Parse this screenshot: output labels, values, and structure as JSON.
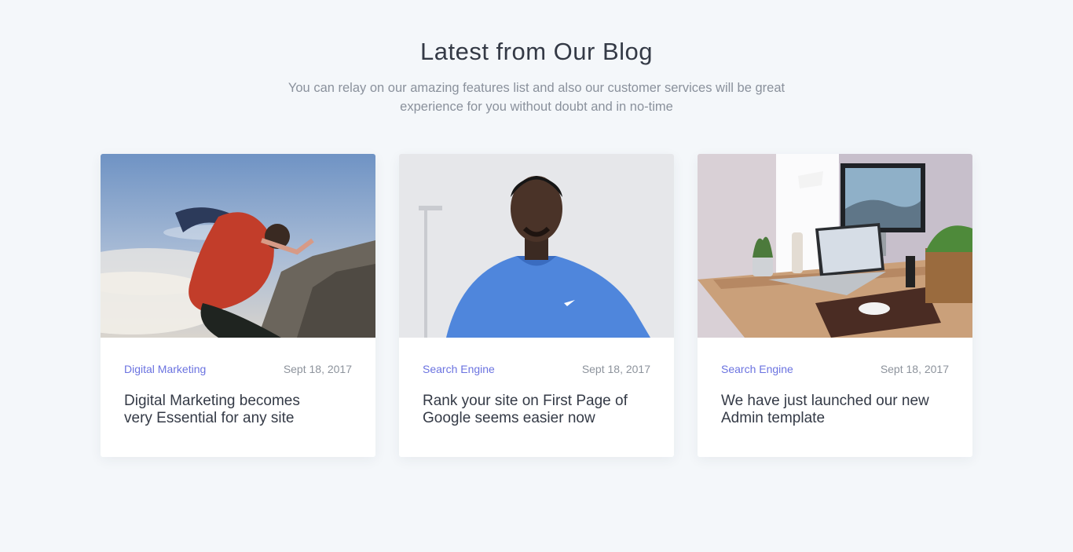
{
  "section": {
    "title": "Latest from Our Blog",
    "subtitle_line1": "You can relay on our amazing features list and also our customer services will be great",
    "subtitle_line2": "experience for you without doubt and in no-time"
  },
  "posts": [
    {
      "category": "Digital Marketing",
      "date": "Sept 18, 2017",
      "title_line1": "Digital Marketing becomes",
      "title_line2": "very Essential for any site",
      "image": "man-jumping-mountains-photo"
    },
    {
      "category": "Search Engine",
      "date": "Sept 18, 2017",
      "title_line1": "Rank your site on First Page of",
      "title_line2": "Google seems easier now",
      "image": "man-blue-shirt-portrait-photo"
    },
    {
      "category": "Search Engine",
      "date": "Sept 18, 2017",
      "title_line1": "We have just launched our new",
      "title_line2": "Admin template",
      "image": "desk-laptop-monitor-photo"
    }
  ],
  "colors": {
    "accent": "#6b73e0",
    "heading": "#343a46",
    "muted": "#8a919c",
    "background": "#f4f7fa"
  }
}
